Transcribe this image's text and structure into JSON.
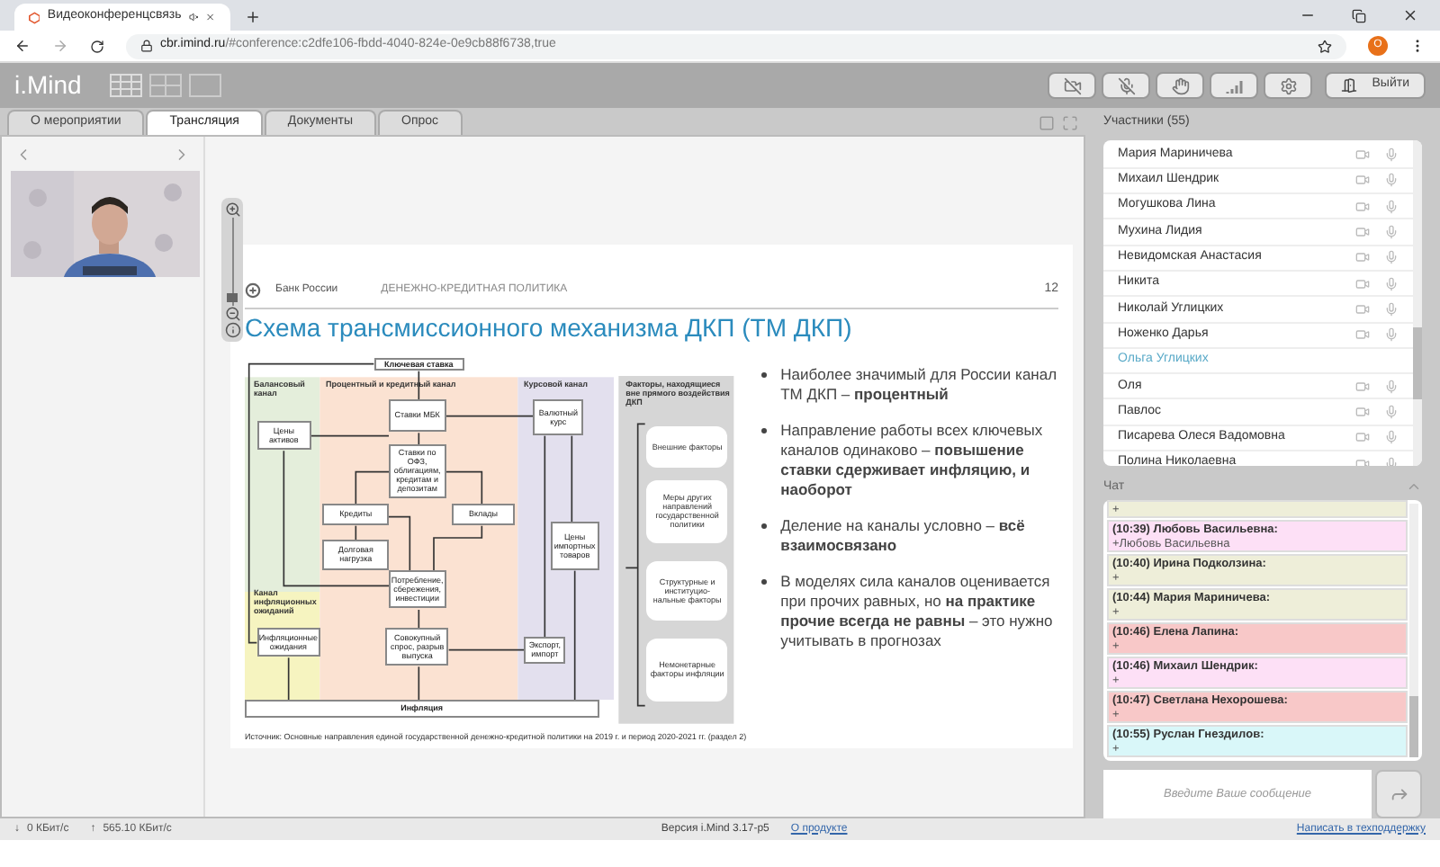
{
  "browser": {
    "tab_title": "Видеоконференцсвязь",
    "url_host": "cbr.imind.ru",
    "url_path": "/#conference:c2dfe106-fbdd-4040-824e-0e9cb88f6738,true",
    "profile_initial": "O"
  },
  "app": {
    "logo": "i.Mind",
    "exit_label": "Выйти"
  },
  "tabs": [
    {
      "label": "О мероприятии",
      "selected": false
    },
    {
      "label": "Трансляция",
      "selected": true
    },
    {
      "label": "Документы",
      "selected": false
    },
    {
      "label": "Опрос",
      "selected": false
    }
  ],
  "slide": {
    "zoom": {
      "level": 0.08
    },
    "org": "Банк России",
    "section": "ДЕНЕЖНО-КРЕДИТНАЯ ПОЛИТИКА",
    "page": "12",
    "title": "Схема трансмиссионного механизма ДКП (ТМ ДКП)",
    "channels": [
      "Балансовый канал",
      "Процентный и кредитный канал",
      "Курсовой канал",
      "Канал инфляционных ожиданий"
    ],
    "nodes": [
      "Ключевая ставка",
      "Ставки МБК",
      "Цены активов",
      "Валютный курс",
      "Ставки по ОФЗ, облигациям, кредитам и депозитам",
      "Кредиты",
      "Вклады",
      "Долговая нагрузка",
      "Цены импортных товаров",
      "Потребление, сбережения, инвестиции",
      "Инфляционные ожидания",
      "Совокупный спрос, разрыв выпуска",
      "Экспорт, импорт",
      "Инфляция"
    ],
    "panel_title": "Факторы, находящиеся вне прямого воздействия ДКП",
    "panel_items": [
      "Внешние факторы",
      "Меры других направлений государственной политики",
      "Структурные и институцио-нальные факторы",
      "Немонетарные факторы инфляции"
    ],
    "source": "Источник: Основные направления единой государственной денежно-кредитной политики на 2019 г. и период 2020-2021 гг. (раздел 2)",
    "bullets": [
      "Наиболее значимый для России канал ТМ ДКП – **процентный**",
      "Направление работы всех ключевых каналов одинаково – **повышение ставки сдерживает инфляцию, и наоборот**",
      "Деление на каналы условно – **всё взаимосвязано**",
      "В моделях сила каналов оценивается при прочих равных, но **на практике прочие всегда не равны** – это нужно учитывать в прогнозах"
    ]
  },
  "participants": {
    "title": "Участники (55)",
    "items": [
      {
        "name": "Мария Мариничева",
        "media": true
      },
      {
        "name": "Михаил Шендрик",
        "media": true
      },
      {
        "name": "Могушкова Лина",
        "media": true
      },
      {
        "name": "Мухина Лидия",
        "media": true
      },
      {
        "name": "Невидомская Анастасия",
        "media": true
      },
      {
        "name": "Никита",
        "media": true
      },
      {
        "name": "Николай Углицких",
        "media": true
      },
      {
        "name": "Ноженко Дарья",
        "media": true
      },
      {
        "name": "Ольга Углицких",
        "media": false
      },
      {
        "name": "Оля",
        "media": true
      },
      {
        "name": "Павлос",
        "media": true
      },
      {
        "name": "Писарева Олеся Вадомовна",
        "media": true
      },
      {
        "name": "Полина Николаевна",
        "media": true
      }
    ]
  },
  "chat": {
    "title": "Чат",
    "placeholder": "Введите Ваше сообщение",
    "messages": [
      {
        "body": "+",
        "color": "#eeeed9"
      },
      {
        "header": "(10:39) Любовь Васильевна:",
        "body": "+Любовь Васильевна",
        "color": "#fde0f6"
      },
      {
        "header": "(10:40) Ирина Подколзина:",
        "body": "+",
        "color": "#eeeed9"
      },
      {
        "header": "(10:44) Мария Мариничева:",
        "body": "+",
        "color": "#eeeed9"
      },
      {
        "header": "(10:46) Елена Лапина:",
        "body": "+",
        "color": "#f8c8c8"
      },
      {
        "header": "(10:46) Михаил Шендрик:",
        "body": "+",
        "color": "#fde0f6"
      },
      {
        "header": "(10:47) Светлана Нехорошева:",
        "body": "+",
        "color": "#f8c8c8"
      },
      {
        "header": "(10:55) Руслан Гнездилов:",
        "body": "+",
        "color": "#d9f7f9"
      }
    ]
  },
  "status": {
    "down_arrow": "↓",
    "up_arrow": "↑",
    "down": "0 КБит/с",
    "up": "565.10 КБит/с",
    "version": "Версия i.Mind 3.17-p5",
    "about": "О продукте",
    "support": "Написать в техподдержку"
  }
}
